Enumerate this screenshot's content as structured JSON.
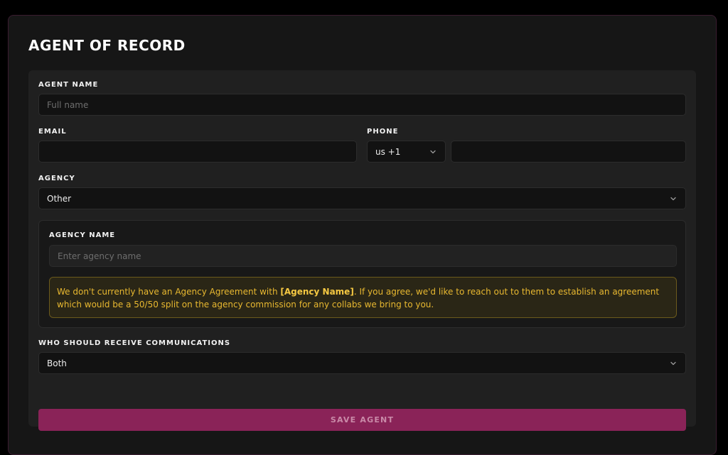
{
  "page": {
    "title": "AGENT OF RECORD"
  },
  "form": {
    "agent_name": {
      "label": "AGENT NAME",
      "value": "",
      "placeholder": "Full name"
    },
    "email": {
      "label": "EMAIL",
      "value": "",
      "placeholder": ""
    },
    "phone": {
      "label": "PHONE",
      "country_code": "us +1",
      "value": "",
      "placeholder": ""
    },
    "agency": {
      "label": "AGENCY",
      "selected": "Other"
    },
    "agency_name": {
      "label": "AGENCY NAME",
      "value": "",
      "placeholder": "Enter agency name"
    },
    "notice": {
      "text_before": "We don't currently have an Agency Agreement with ",
      "highlight": "[Agency Name]",
      "text_after": ". If you agree, we'd like to reach out to them to establish an agreement which would be a 50/50 split on the agency commission for any collabs we bring to you."
    },
    "communications": {
      "label": "WHO SHOULD RECEIVE COMMUNICATIONS",
      "selected": "Both"
    },
    "save_label": "SAVE AGENT"
  },
  "colors": {
    "accent": "#8a2358",
    "warning_text": "#e8b830",
    "warning_bg": "#2a2616"
  },
  "icons": {
    "dropdown": "chevron-down-icon"
  }
}
